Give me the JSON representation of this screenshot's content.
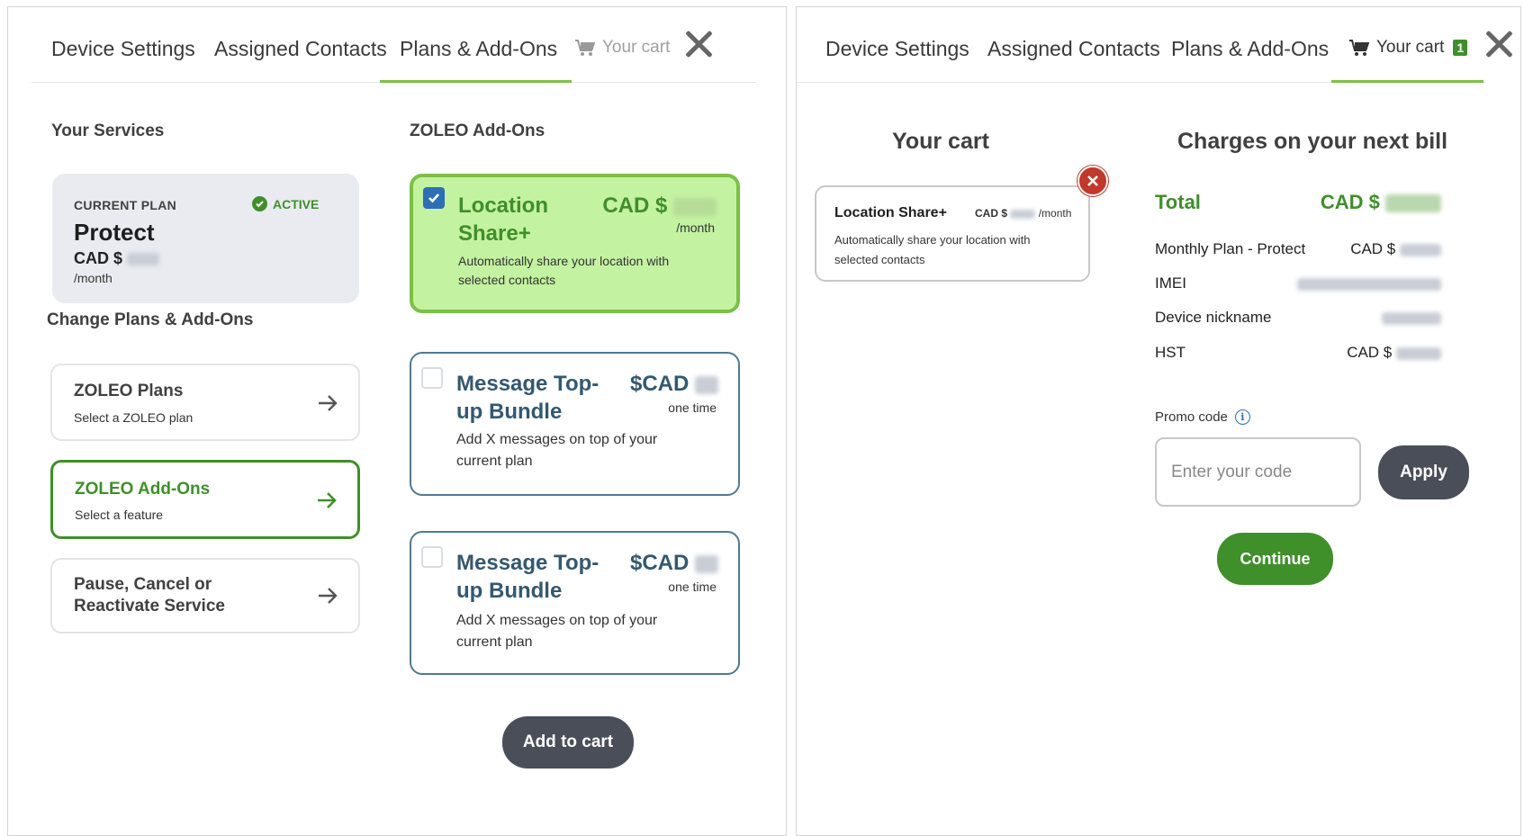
{
  "left": {
    "tabs": [
      {
        "label": "Device Settings"
      },
      {
        "label": "Assigned Contacts"
      },
      {
        "label": "Plans & Add-Ons"
      }
    ],
    "cart_tab": {
      "label": "Your cart"
    },
    "your_services_title": "Your Services",
    "current_plan": {
      "label": "CURRENT PLAN",
      "status": "ACTIVE",
      "name": "Protect",
      "price_prefix": "CAD $",
      "per": "/month"
    },
    "change_title": "Change Plans & Add-Ons",
    "nav_cards": [
      {
        "title": "ZOLEO Plans",
        "sub": "Select a ZOLEO plan"
      },
      {
        "title": "ZOLEO Add-Ons",
        "sub": "Select a feature"
      },
      {
        "title": "Pause, Cancel or Reactivate Service",
        "sub": ""
      }
    ],
    "addons_title": "ZOLEO Add-Ons",
    "addons": [
      {
        "name": "Location Share+",
        "price_prefix": "CAD $",
        "price_note": "/month",
        "desc": "Automatically share your location with selected contacts",
        "checked": true
      },
      {
        "name": "Message Top-up Bundle",
        "price_prefix": "$CAD",
        "price_note": "one time",
        "desc": "Add X messages on top of your current plan",
        "checked": false
      },
      {
        "name": "Message Top-up Bundle",
        "price_prefix": "$CAD",
        "price_note": "one time",
        "desc": "Add X messages on top of your current plan",
        "checked": false
      }
    ],
    "add_to_cart": "Add to cart"
  },
  "right": {
    "tabs": [
      {
        "label": "Device Settings"
      },
      {
        "label": "Assigned Contacts"
      },
      {
        "label": "Plans & Add-Ons"
      }
    ],
    "cart_tab": {
      "label": "Your cart",
      "count": "1"
    },
    "cart_title": "Your cart",
    "cart_item": {
      "name": "Location Share+",
      "price_prefix": "CAD $",
      "per": "/month",
      "desc": "Automatically share your location with selected contacts"
    },
    "bill_title": "Charges on your next bill",
    "total": {
      "label": "Total",
      "prefix": "CAD $"
    },
    "rows": [
      {
        "label": "Monthly Plan - Protect",
        "prefix": "CAD $"
      },
      {
        "label": "IMEI",
        "prefix": ""
      },
      {
        "label": "Device nickname",
        "prefix": ""
      },
      {
        "label": "HST",
        "prefix": "CAD $"
      }
    ],
    "promo": {
      "label": "Promo code",
      "placeholder": "Enter your code",
      "value": ""
    },
    "apply": "Apply",
    "continue": "Continue"
  },
  "colors": {
    "green": "#3f8f2a",
    "light_green": "#c3f2a0",
    "accent_line": "#7bc047",
    "navy_text": "#34586f",
    "dark_button": "#4a4e59",
    "danger": "#c0392b",
    "checkbox_blue": "#2c6fb5"
  },
  "icons": [
    "cart-icon",
    "close-icon",
    "check-circle-icon",
    "arrow-right-icon",
    "checkbox-icon",
    "remove-icon",
    "info-icon"
  ]
}
